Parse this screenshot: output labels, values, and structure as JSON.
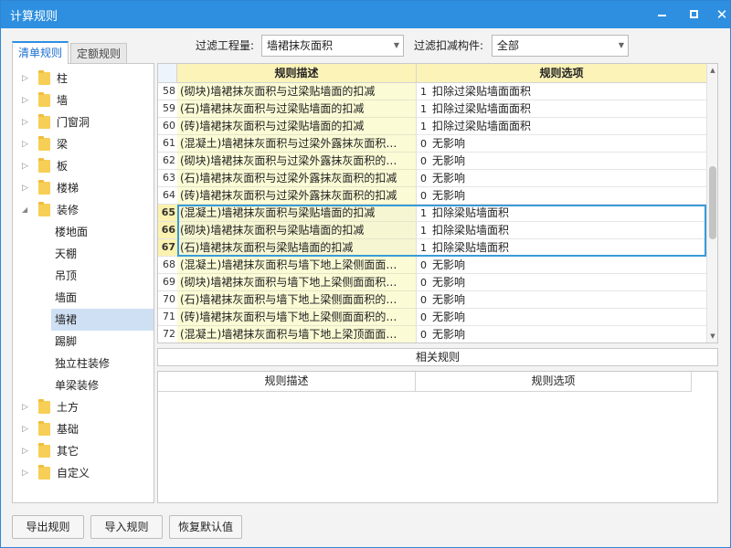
{
  "window": {
    "title": "计算规则",
    "minimize": "—",
    "maximize": "□",
    "close": "✕"
  },
  "tabs": [
    {
      "label": "清单规则",
      "active": true
    },
    {
      "label": "定额规则",
      "active": false
    }
  ],
  "filters": {
    "quantity_label": "过滤工程量:",
    "quantity_value": "墙裙抹灰面积",
    "deduct_label": "过滤扣减构件:",
    "deduct_value": "全部"
  },
  "tree": {
    "top_items": [
      {
        "label": "柱",
        "expanded": false
      },
      {
        "label": "墙",
        "expanded": false
      },
      {
        "label": "门窗洞",
        "expanded": false
      },
      {
        "label": "梁",
        "expanded": false
      },
      {
        "label": "板",
        "expanded": false
      },
      {
        "label": "楼梯",
        "expanded": false
      },
      {
        "label": "装修",
        "expanded": true
      }
    ],
    "sub_items": [
      {
        "label": "楼地面",
        "selected": false
      },
      {
        "label": "天棚",
        "selected": false
      },
      {
        "label": "吊顶",
        "selected": false
      },
      {
        "label": "墙面",
        "selected": false
      },
      {
        "label": "墙裙",
        "selected": true
      },
      {
        "label": "踢脚",
        "selected": false
      },
      {
        "label": "独立柱装修",
        "selected": false
      },
      {
        "label": "单梁装修",
        "selected": false
      }
    ],
    "bottom_items": [
      {
        "label": "土方",
        "expanded": false
      },
      {
        "label": "基础",
        "expanded": false
      },
      {
        "label": "其它",
        "expanded": false
      },
      {
        "label": "自定义",
        "expanded": false
      }
    ]
  },
  "grid": {
    "columns": [
      "规则描述",
      "规则选项"
    ],
    "rows": [
      {
        "num": "58",
        "desc": "(砌块)墙裙抹灰面积与过梁贴墙面的扣减",
        "code": "1",
        "option": "扣除过梁贴墙面面积",
        "highlight": false
      },
      {
        "num": "59",
        "desc": "(石)墙裙抹灰面积与过梁贴墙面的扣减",
        "code": "1",
        "option": "扣除过梁贴墙面面积",
        "highlight": false
      },
      {
        "num": "60",
        "desc": "(砖)墙裙抹灰面积与过梁贴墙面的扣减",
        "code": "1",
        "option": "扣除过梁贴墙面面积",
        "highlight": false
      },
      {
        "num": "61",
        "desc": "(混凝土)墙裙抹灰面积与过梁外露抹灰面积…",
        "code": "0",
        "option": "无影响",
        "highlight": false
      },
      {
        "num": "62",
        "desc": "(砌块)墙裙抹灰面积与过梁外露抹灰面积的…",
        "code": "0",
        "option": "无影响",
        "highlight": false
      },
      {
        "num": "63",
        "desc": "(石)墙裙抹灰面积与过梁外露抹灰面积的扣减",
        "code": "0",
        "option": "无影响",
        "highlight": false
      },
      {
        "num": "64",
        "desc": "(砖)墙裙抹灰面积与过梁外露抹灰面积的扣减",
        "code": "0",
        "option": "无影响",
        "highlight": false
      },
      {
        "num": "65",
        "desc": "(混凝土)墙裙抹灰面积与梁贴墙面的扣减",
        "code": "1",
        "option": "扣除梁贴墙面积",
        "highlight": true
      },
      {
        "num": "66",
        "desc": "(砌块)墙裙抹灰面积与梁贴墙面的扣减",
        "code": "1",
        "option": "扣除梁贴墙面积",
        "highlight": true
      },
      {
        "num": "67",
        "desc": "(石)墙裙抹灰面积与梁贴墙面的扣减",
        "code": "1",
        "option": "扣除梁贴墙面积",
        "highlight": true
      },
      {
        "num": "68",
        "desc": "(混凝土)墙裙抹灰面积与墙下地上梁侧面面…",
        "code": "0",
        "option": "无影响",
        "highlight": false
      },
      {
        "num": "69",
        "desc": "(砌块)墙裙抹灰面积与墙下地上梁侧面面积…",
        "code": "0",
        "option": "无影响",
        "highlight": false
      },
      {
        "num": "70",
        "desc": "(石)墙裙抹灰面积与墙下地上梁侧面面积的…",
        "code": "0",
        "option": "无影响",
        "highlight": false
      },
      {
        "num": "71",
        "desc": "(砖)墙裙抹灰面积与墙下地上梁侧面面积的…",
        "code": "0",
        "option": "无影响",
        "highlight": false
      },
      {
        "num": "72",
        "desc": "(混凝土)墙裙抹灰面积与墙下地上梁顶面面…",
        "code": "0",
        "option": "无影响",
        "highlight": false
      }
    ]
  },
  "related": {
    "title": "相关规则",
    "columns": [
      "规则描述",
      "规则选项"
    ]
  },
  "buttons": {
    "export": "导出规则",
    "import": "导入规则",
    "restore": "恢复默认值"
  },
  "colors": {
    "titlebar": "#2e8fe0",
    "header_yellow": "#fbf3b8",
    "desc_yellow": "#fbfbd6",
    "selection_border": "#3a9bd8",
    "tree_selected": "#cfe0f4"
  }
}
